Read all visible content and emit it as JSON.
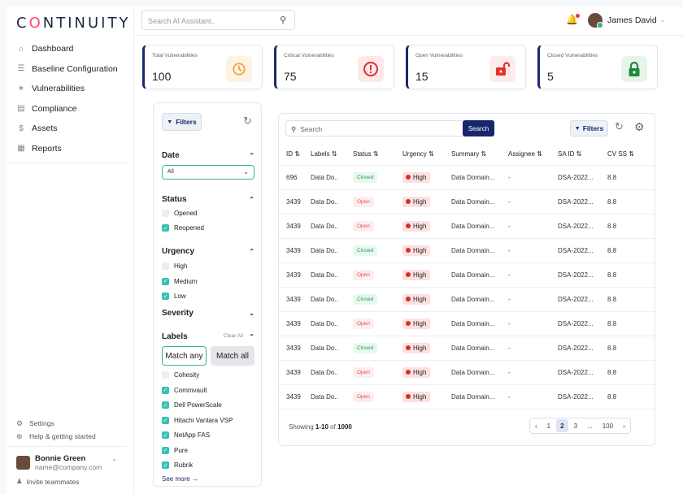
{
  "brand": {
    "logo_text": "CONTINUITY"
  },
  "sidebar": {
    "items": [
      {
        "label": "Dashboard",
        "icon": "home-icon"
      },
      {
        "label": "Baseline Configuration",
        "icon": "baseline-icon"
      },
      {
        "label": "Vulnerabilities",
        "icon": "bug-icon"
      },
      {
        "label": "Compliance",
        "icon": "compliance-icon"
      },
      {
        "label": "Assets",
        "icon": "dollar-icon"
      },
      {
        "label": "Reports",
        "icon": "report-icon"
      }
    ],
    "bottom": [
      {
        "label": "Settings",
        "icon": "gear-icon"
      },
      {
        "label": "Help & getting started",
        "icon": "help-icon"
      }
    ],
    "user": {
      "name": "Bonnie Green",
      "email": "name@company.com"
    },
    "invite": "Invite teammates"
  },
  "topbar": {
    "search_placeholder": "Search AI Assistant..",
    "user_name": "James David"
  },
  "stats": [
    {
      "title": "Total Vulnerabilities",
      "value": "100",
      "icon": "timer-icon",
      "color": "#f2a541"
    },
    {
      "title": "Critical Vulnerabilities",
      "value": "75",
      "icon": "alert-circle-icon",
      "color": "#d63333"
    },
    {
      "title": "Open Vulnerabilities",
      "value": "15",
      "icon": "unlock-icon",
      "color": "#e5322b"
    },
    {
      "title": "Closed Vulnerabilities",
      "value": "5",
      "icon": "lock-icon",
      "color": "#1f8a3a"
    }
  ],
  "filters": {
    "button": "Filters",
    "date": {
      "title": "Date",
      "selected": "All"
    },
    "status": {
      "title": "Status",
      "options": [
        {
          "label": "Opened",
          "checked": false
        },
        {
          "label": "Reopened",
          "checked": true
        }
      ]
    },
    "urgency": {
      "title": "Urgency",
      "options": [
        {
          "label": "High",
          "checked": false
        },
        {
          "label": "Medium",
          "checked": true
        },
        {
          "label": "Low",
          "checked": true
        }
      ]
    },
    "severity": {
      "title": "Severity"
    },
    "labels": {
      "title": "Labels",
      "clear": "Clear All",
      "match_any": "Match any",
      "match_all": "Match all",
      "options": [
        {
          "label": "Cohesity",
          "checked": false
        },
        {
          "label": "Commvault",
          "checked": true
        },
        {
          "label": "Dell PowerScale",
          "checked": true
        },
        {
          "label": "Hitachi Vantara VSP",
          "checked": true
        },
        {
          "label": "NetApp FAS",
          "checked": true
        },
        {
          "label": "Pure",
          "checked": true
        },
        {
          "label": "Rubrik",
          "checked": true
        }
      ]
    },
    "see_more": "See more →"
  },
  "table": {
    "search_placeholder": "Search",
    "search_button": "Search",
    "filters_button": "Filters",
    "columns": [
      "ID",
      "Labels",
      "Status",
      "Urgency",
      "Summary",
      "Assignee",
      "SA ID",
      "CV SS"
    ],
    "rows": [
      [
        "696",
        "Data Do..",
        "Closed",
        "High",
        "Data Domain...",
        "-",
        "DSA-2022...",
        "8.8"
      ],
      [
        "3439",
        "Data Do..",
        "Open",
        "High",
        "Data Domain...",
        "-",
        "DSA-2022...",
        "8.8"
      ],
      [
        "3439",
        "Data Do..",
        "Open",
        "High",
        "Data Domain...",
        "-",
        "DSA-2022...",
        "8.8"
      ],
      [
        "3439",
        "Data Do..",
        "Closed",
        "High",
        "Data Domain...",
        "-",
        "DSA-2022...",
        "8.8"
      ],
      [
        "3439",
        "Data Do..",
        "Open",
        "High",
        "Data Domain...",
        "-",
        "DSA-2022...",
        "8.8"
      ],
      [
        "3439",
        "Data Do..",
        "Closed",
        "High",
        "Data Domain...",
        "-",
        "DSA-2022...",
        "8.8"
      ],
      [
        "3439",
        "Data Do..",
        "Open",
        "High",
        "Data Domain...",
        "-",
        "DSA-2022...",
        "8.8"
      ],
      [
        "3439",
        "Data Do..",
        "Closed",
        "High",
        "Data Domain...",
        "-",
        "DSA-2022...",
        "8.8"
      ],
      [
        "3439",
        "Data Do..",
        "Open",
        "High",
        "Data Domain...",
        "-",
        "DSA-2022...",
        "8.8"
      ],
      [
        "3439",
        "Data Do..",
        "Open",
        "High",
        "Data Domain...",
        "-",
        "DSA-2022...",
        "8.8"
      ]
    ],
    "showing_prefix": "Showing ",
    "showing_range": "1-10",
    "showing_of": " of ",
    "showing_total": "1000",
    "pages": [
      "‹",
      "1",
      "2",
      "3",
      "...",
      "100",
      "›"
    ],
    "active_page": "2"
  }
}
